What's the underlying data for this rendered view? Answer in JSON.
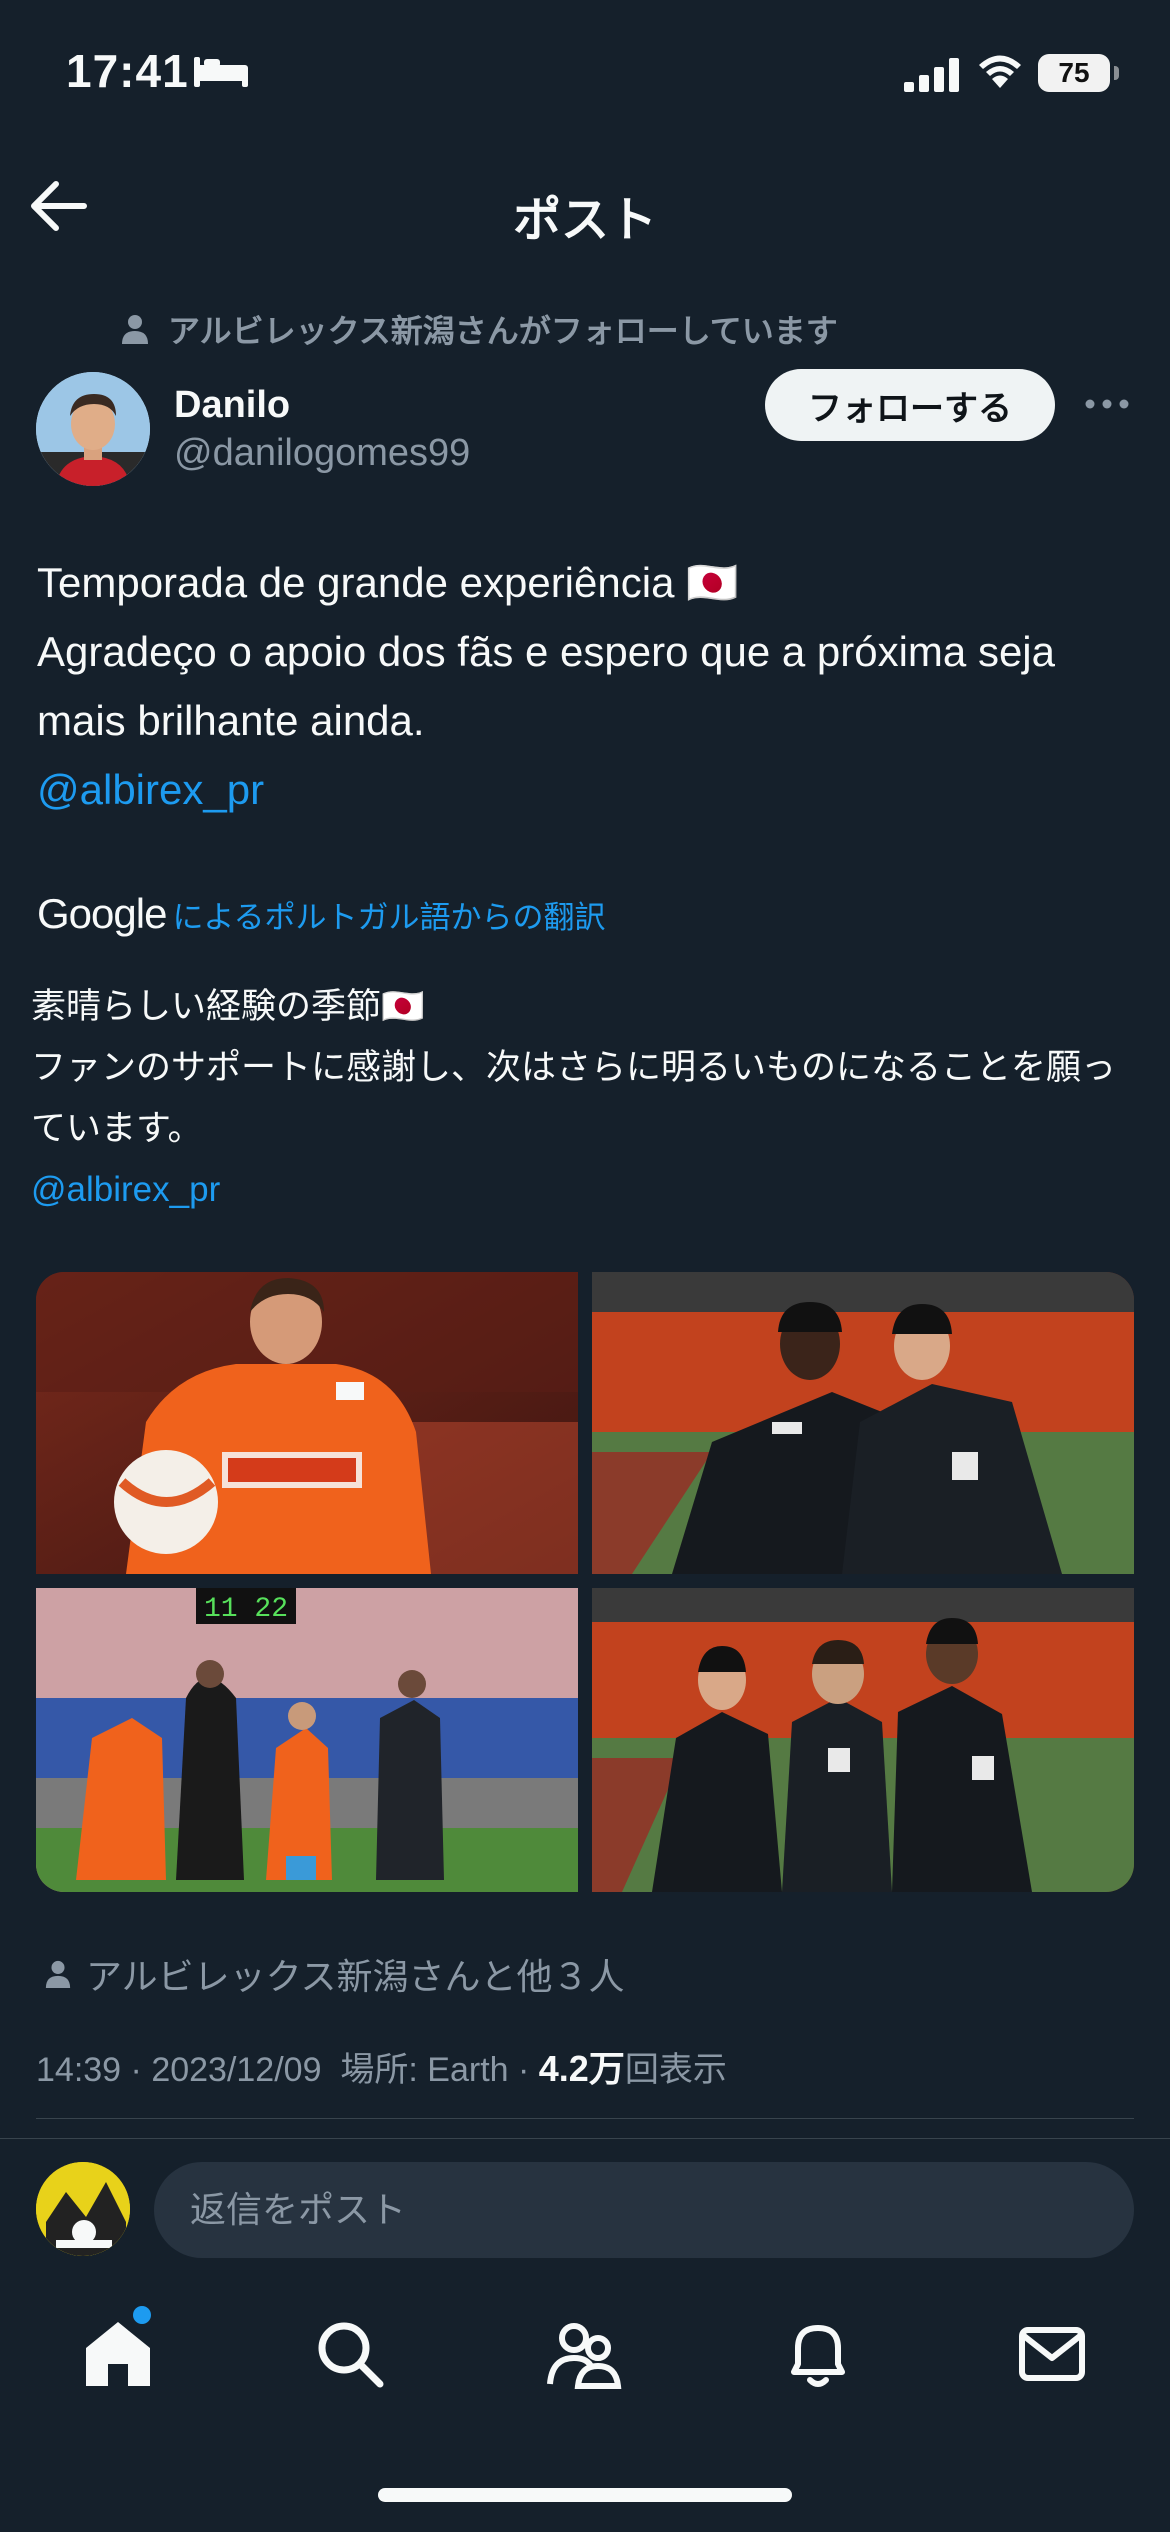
{
  "status_bar": {
    "time": "17:41",
    "battery": "75"
  },
  "header": {
    "title": "ポスト"
  },
  "social_context": {
    "followed_by": "アルビレックス新潟さんがフォローしています"
  },
  "author": {
    "name": "Danilo",
    "handle": "@danilogomes99"
  },
  "follow_button": {
    "label": "フォローする"
  },
  "tweet": {
    "line1": "Temporada de grande experiência 🇯🇵",
    "line2": "Agradeço o apoio dos fãs e espero que a próxima seja mais brilhante ainda.",
    "mention": "@albirex_pr"
  },
  "translation": {
    "provider": "Google",
    "link": "によるポルトガル語からの翻訳",
    "line1": "素晴らしい経験の季節🇯🇵",
    "line2": "ファンのサポートに感謝し、次はさらに明るいものになることを願っています。",
    "mention": "@albirex_pr"
  },
  "media": {
    "photo_1_alt": "orange-jersey-player-holding-ball",
    "photo_2_alt": "two-players-in-black-jackets-stadium",
    "photo_3_alt": "substitution-board-players-on-field",
    "photo_4_alt": "three-players-in-black-jackets-stadium",
    "sub_board": "11 22"
  },
  "liked_by": {
    "text": "アルビレックス新潟さんと他３人"
  },
  "meta": {
    "time": "14:39",
    "sep": " · ",
    "date": "2023/12/09",
    "place": "場所: Earth",
    "views_num": "4.2万",
    "views_label": "回表示"
  },
  "reply": {
    "placeholder": "返信をポスト"
  },
  "tabs": [
    "home-icon",
    "search-icon",
    "communities-icon",
    "notifications-icon",
    "messages-icon"
  ],
  "colors": {
    "background": "#15202b",
    "accent": "#1d9bf0",
    "muted": "#8b98a5"
  }
}
